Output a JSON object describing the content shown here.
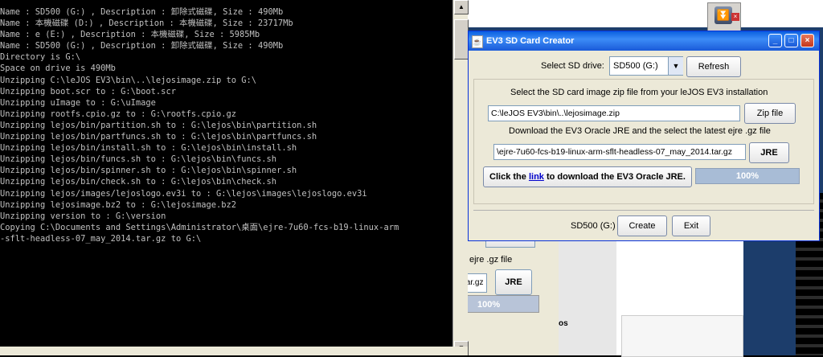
{
  "console": {
    "lines": [
      "Name : SD500 (G:) , Description : 卸除式磁碟, Size : 490Mb",
      "Name : 本機磁碟 (D:) , Description : 本機磁碟, Size : 23717Mb",
      "Name : e (E:) , Description : 本機磁碟, Size : 5985Mb",
      "Name : SD500 (G:) , Description : 卸除式磁碟, Size : 490Mb",
      "Directory is G:\\",
      "Space on drive is 490Mb",
      "Unzipping C:\\leJOS EV3\\bin\\..\\lejosimage.zip to G:\\",
      "Unzipping boot.scr to : G:\\boot.scr",
      "Unzipping uImage to : G:\\uImage",
      "Unzipping rootfs.cpio.gz to : G:\\rootfs.cpio.gz",
      "Unzipping lejos/bin/partition.sh to : G:\\lejos\\bin\\partition.sh",
      "Unzipping lejos/bin/partfuncs.sh to : G:\\lejos\\bin\\partfuncs.sh",
      "Unzipping lejos/bin/install.sh to : G:\\lejos\\bin\\install.sh",
      "Unzipping lejos/bin/funcs.sh to : G:\\lejos\\bin\\funcs.sh",
      "Unzipping lejos/bin/spinner.sh to : G:\\lejos\\bin\\spinner.sh",
      "Unzipping lejos/bin/check.sh to : G:\\lejos\\bin\\check.sh",
      "Unzipping lejos/images/lejoslogo.ev3i to : G:\\lejos\\images\\lejoslogo.ev3i",
      "Unzipping lejosimage.bz2 to : G:\\lejosimage.bz2",
      "Unzipping version to : G:\\version",
      "Copying C:\\Documents and Settings\\Administrator\\桌面\\ejre-7u60-fcs-b19-linux-arm",
      "-sflt-headless-07_may_2014.tar.gz to G:\\"
    ],
    "bottom_text": "..."
  },
  "ev3": {
    "title": "EV3 SD Card Creator",
    "title_icon": "java-icon",
    "select_drive_label": "Select SD drive:",
    "drive_selected": "SD500 (G:)",
    "refresh_label": "Refresh",
    "zip_prompt": "Select the SD card image zip file from your leJOS EV3 installation",
    "zip_path": "C:\\leJOS EV3\\bin\\..\\lejosimage.zip",
    "zip_button": "Zip file",
    "jre_prompt": "Download the EV3 Oracle JRE and the select the latest ejre .gz file",
    "jre_path": "\\ejre-7u60-fcs-b19-linux-arm-sflt-headless-07_may_2014.tar.gz",
    "jre_button": "JRE",
    "click_prefix": "Click the ",
    "click_link": "link",
    "click_suffix": " to download the EV3 Oracle JRE.",
    "progress_percent": 100,
    "progress_text": "100%",
    "footer_drive": "SD500 (G:)",
    "create_label": "Create",
    "exit_label": "Exit"
  },
  "behind": {
    "label": "ejre .gz file",
    "field": "tar.gz",
    "button": "JRE",
    "progress_text": "100%",
    "panel_text": "os"
  },
  "colors": {
    "titlebar": "#0a5fe0",
    "console_text": "#c0c0c0",
    "progress": "#b8c8dc",
    "link": "#0000cc"
  }
}
